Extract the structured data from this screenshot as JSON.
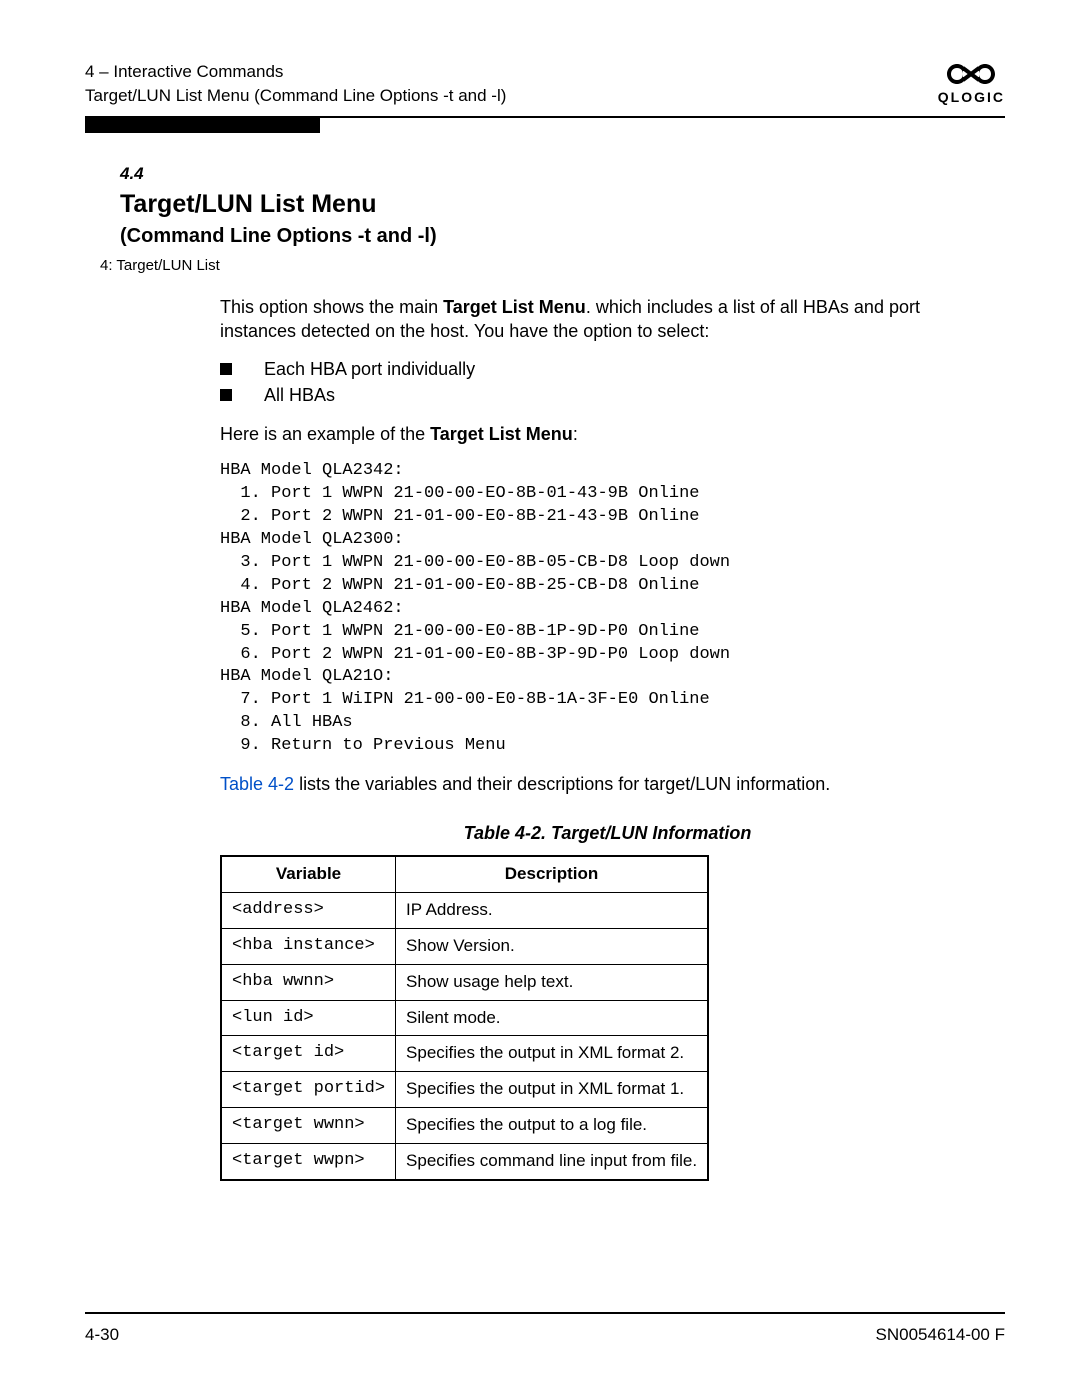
{
  "header": {
    "breadcrumb1": "4 – Interactive Commands",
    "breadcrumb2": "Target/LUN List Menu (Command Line Options -t and -l)",
    "logo_text": "QLOGIC"
  },
  "section": {
    "number": "4.4",
    "title": "Target/LUN List Menu",
    "subtitle": "(Command Line Options -t and -l)",
    "small": "4: Target/LUN List"
  },
  "body": {
    "p1a": "This option shows the main ",
    "p1b_bold": "Target List Menu",
    "p1c": ". which includes a list of all HBAs and port instances detected on the host. You have the option to select:",
    "bullets": {
      "0": "Each HBA port individually",
      "1": "All HBAs"
    },
    "p2a": "Here is an example of the ",
    "p2b_bold": "Target List Menu",
    "p2c": ":",
    "code": "HBA Model QLA2342:\n  1. Port 1 WWPN 21-00-00-EO-8B-01-43-9B Online\n  2. Port 2 WWPN 21-01-00-E0-8B-21-43-9B Online\nHBA Model QLA2300:\n  3. Port 1 WWPN 21-00-00-E0-8B-05-CB-D8 Loop down\n  4. Port 2 WWPN 21-01-00-E0-8B-25-CB-D8 Online\nHBA Model QLA2462:\n  5. Port 1 WWPN 21-00-00-E0-8B-1P-9D-P0 Online\n  6. Port 2 WWPN 21-01-00-E0-8B-3P-9D-P0 Loop down\nHBA Model QLA21O:\n  7. Port 1 WiIPN 21-00-00-E0-8B-1A-3F-E0 Online\n  8. All HBAs\n  9. Return to Previous Menu",
    "p3_link": "Table 4-2",
    "p3_rest": " lists the variables and their descriptions for target/LUN information."
  },
  "table": {
    "caption": "Table 4-2. Target/LUN Information",
    "headers": {
      "0": "Variable",
      "1": "Description"
    },
    "rows": {
      "0": {
        "var": "<address>",
        "desc": "IP Address."
      },
      "1": {
        "var": "<hba instance>",
        "desc": "Show Version."
      },
      "2": {
        "var": "<hba wwnn>",
        "desc": "Show usage help text."
      },
      "3": {
        "var": "<lun id>",
        "desc": "Silent mode."
      },
      "4": {
        "var": "<target id>",
        "desc": "Specifies the output in XML format 2."
      },
      "5": {
        "var": "<target portid>",
        "desc": "Specifies the output in XML format 1."
      },
      "6": {
        "var": "<target wwnn>",
        "desc": "Specifies the output to a log file."
      },
      "7": {
        "var": "<target wwpn>",
        "desc": "Specifies command line input from file."
      }
    }
  },
  "footer": {
    "left": "4-30",
    "right": "SN0054614-00  F"
  }
}
